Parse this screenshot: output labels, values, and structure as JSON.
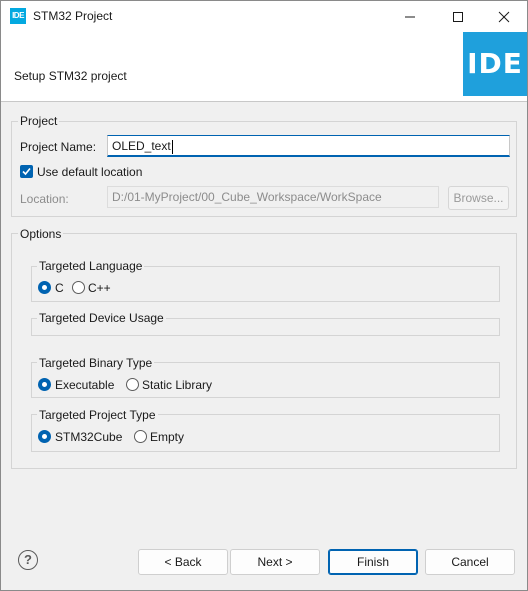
{
  "window": {
    "title": "STM32 Project",
    "app_icon_text": "IDE"
  },
  "header": {
    "subtitle": "Setup STM32 project",
    "logo_text": "IDE"
  },
  "project": {
    "group_label": "Project",
    "name_label": "Project Name:",
    "name_value": "OLED_text",
    "default_location_label": "Use default location",
    "default_location_checked": true,
    "location_label": "Location:",
    "location_value": "D:/01-MyProject/00_Cube_Workspace/WorkSpace",
    "browse_label": "Browse..."
  },
  "options": {
    "group_label": "Options",
    "language": {
      "label": "Targeted Language",
      "choices": [
        "C",
        "C++"
      ],
      "selected": "C"
    },
    "device_usage": {
      "label": "Targeted Device Usage"
    },
    "binary_type": {
      "label": "Targeted Binary Type",
      "choices": [
        "Executable",
        "Static Library"
      ],
      "selected": "Executable"
    },
    "project_type": {
      "label": "Targeted Project Type",
      "choices": [
        "STM32Cube",
        "Empty"
      ],
      "selected": "STM32Cube"
    }
  },
  "footer": {
    "help_icon": "?",
    "back_label": "< Back",
    "next_label": "Next >",
    "finish_label": "Finish",
    "cancel_label": "Cancel"
  },
  "colors": {
    "accent": "#0063b1",
    "logo": "#1fa0dc"
  }
}
